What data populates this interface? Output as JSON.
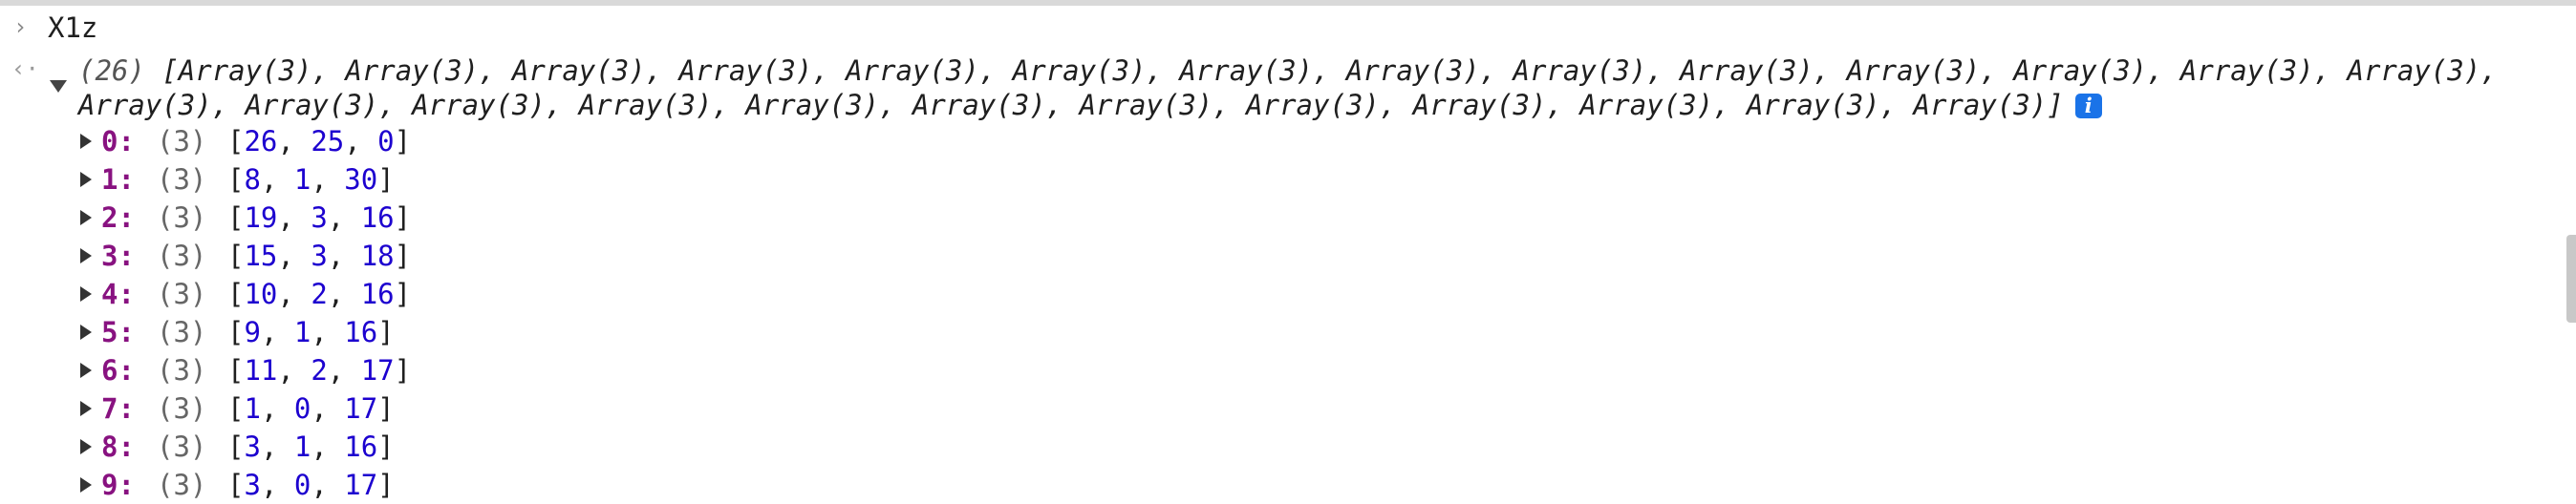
{
  "console": {
    "input_command": "X1z",
    "summary": {
      "count_label": "(26)",
      "items_text": "[Array(3), Array(3), Array(3), Array(3), Array(3), Array(3), Array(3), Array(3), Array(3), Array(3), Array(3), Array(3), Array(3), Array(3), Array(3), Array(3), Array(3), Array(3), Array(3), Array(3), Array(3), Array(3), Array(3), Array(3), Array(3), Array(3)]",
      "info_badge": "i"
    },
    "entries": [
      {
        "key": "0:",
        "len": "(3)",
        "values": [
          26,
          25,
          0
        ]
      },
      {
        "key": "1:",
        "len": "(3)",
        "values": [
          8,
          1,
          30
        ]
      },
      {
        "key": "2:",
        "len": "(3)",
        "values": [
          19,
          3,
          16
        ]
      },
      {
        "key": "3:",
        "len": "(3)",
        "values": [
          15,
          3,
          18
        ]
      },
      {
        "key": "4:",
        "len": "(3)",
        "values": [
          10,
          2,
          16
        ]
      },
      {
        "key": "5:",
        "len": "(3)",
        "values": [
          9,
          1,
          16
        ]
      },
      {
        "key": "6:",
        "len": "(3)",
        "values": [
          11,
          2,
          17
        ]
      },
      {
        "key": "7:",
        "len": "(3)",
        "values": [
          1,
          0,
          17
        ]
      },
      {
        "key": "8:",
        "len": "(3)",
        "values": [
          3,
          1,
          16
        ]
      },
      {
        "key": "9:",
        "len": "(3)",
        "values": [
          3,
          0,
          17
        ]
      }
    ]
  },
  "icons": {
    "prompt": "chevron-right-icon",
    "return": "return-arrow-icon",
    "expand": "caret-down-icon",
    "collapsed": "caret-right-icon",
    "info": "info-icon"
  },
  "colors": {
    "key": "#881280",
    "number": "#1c00cf",
    "info_badge": "#1a73e8"
  }
}
